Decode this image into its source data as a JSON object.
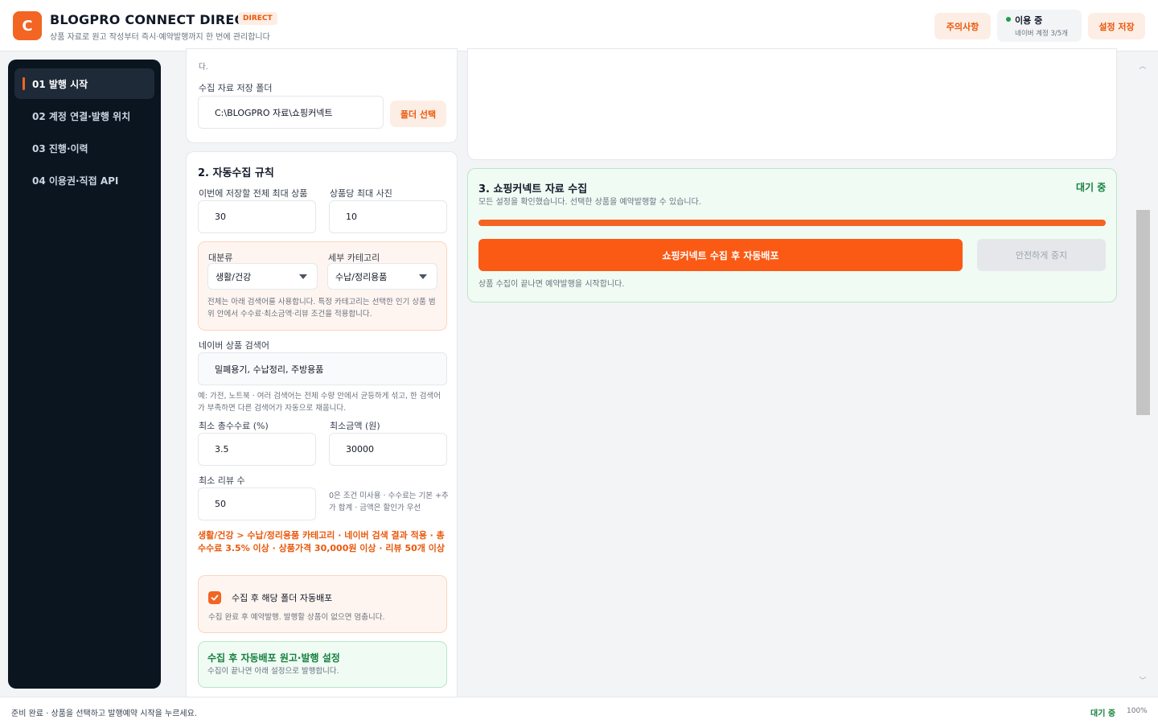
{
  "header": {
    "logo_letter": "C",
    "title": "BLOGPRO CONNECT DIRECT",
    "badge": "DIRECT",
    "subtitle": "상품 자료로 원고 작성부터 즉시·예약발행까지 한 번에 관리합니다",
    "notice_button": "주의사항",
    "status_label": "이용 중",
    "status_sub": "네이버 계정 3/5개",
    "save_button": "설정 저장"
  },
  "sidebar": {
    "items": [
      {
        "label": "01  발행 시작"
      },
      {
        "label": "02  계정 연결·발행 위치"
      },
      {
        "label": "03  진행·이력"
      },
      {
        "label": "04  이용권·직접 API"
      }
    ]
  },
  "folder_section": {
    "top_fragment": "다.",
    "label": "수집 자료 저장 폴더",
    "path": "C:\\BLOGPRO 자료\\쇼핑커넥트",
    "select_button": "폴더 선택"
  },
  "rules": {
    "title": "2. 자동수집 규칙",
    "max_total_label": "이번에 저장할 전체 최대 상품",
    "max_total_value": "30",
    "max_photos_label": "상품당 최대 사진",
    "max_photos_value": "10",
    "category_label": "대분류",
    "category_value": "생활/건강",
    "subcategory_label": "세부 카테고리",
    "subcategory_value": "수납/정리용품",
    "category_hint": "전체는 아래 검색어를 사용합니다. 특정 카테고리는 선택한 인기 상품 범위 안에서 수수료·최소금액·리뷰 조건을 적용합니다.",
    "keyword_label": "네이버 상품 검색어",
    "keyword_value": "밀폐용기, 수납정리, 주방용품",
    "keyword_hint": "예: 가전, 노트북 · 여러 검색어는 전체 수량 안에서 균등하게 섞고, 한 검색어가 부족하면 다른 검색어가 자동으로 채웁니다.",
    "min_commission_label": "최소 총수수료 (%)",
    "min_commission_value": "3.5",
    "min_price_label": "최소금액 (원)",
    "min_price_value": "30000",
    "min_reviews_label": "최소 리뷰 수",
    "min_reviews_value": "50",
    "min_reviews_hint": "0은 조건 미사용 · 수수료는 기본 +추가 합계 · 금액은 할인가 우선",
    "summary": "생활/건강 > 수납/정리용품 카테고리 · 네이버 검색 결과 적용 · 총수수료 3.5% 이상 · 상품가격 30,000원 이상 · 리뷰 50개 이상",
    "auto_deploy_label": "수집 후 해당 폴더 자동배포",
    "auto_deploy_hint": "수집 완료 후 예약발행. 발행할 상품이 없으면 멈춥니다.",
    "publish_title": "수집 후 자동배포 원고·발행 설정",
    "publish_hint": "수집이 끝나면 아래 설정으로 발행합니다."
  },
  "collect": {
    "title": "3. 쇼핑커넥트 자료 수집",
    "status": "대기 중",
    "description": "모든 설정을 확인했습니다. 선택한 상품을 예약발행할 수 있습니다.",
    "progress": 1.0,
    "primary_button": "쇼핑커넥트 수집 후 자동배포",
    "stop_button": "안전하게 중지",
    "footnote": "상품 수집이 끝나면 예약발행을 시작합니다."
  },
  "footer": {
    "message": "준비 완료 · 상품을 선택하고 발행예약 시작을 누르세요.",
    "status": "대기 중",
    "zoom": "100%"
  },
  "colors": {
    "accent": "#f26522",
    "sidebar_bg": "#0b1520",
    "success": "#15803d"
  }
}
